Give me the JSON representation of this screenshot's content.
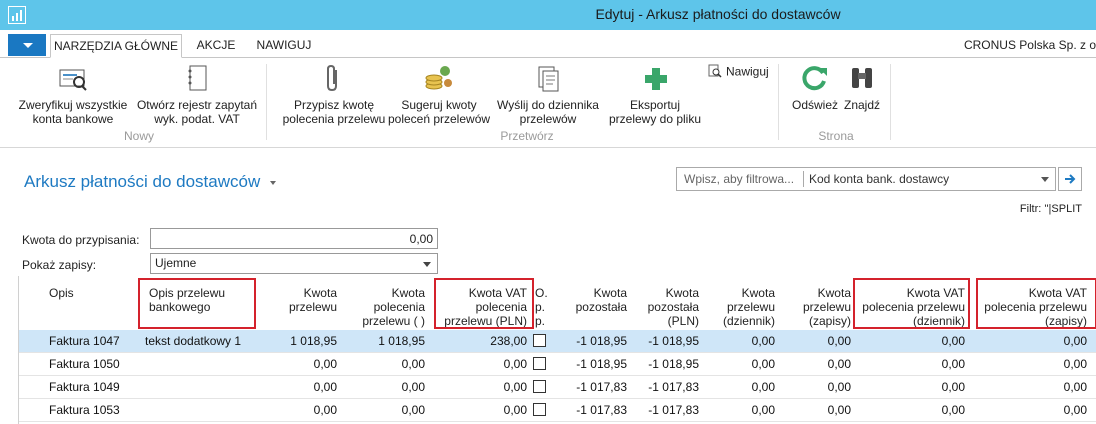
{
  "window": {
    "title": "Edytuj - Arkusz płatności do dostawców"
  },
  "ribbon_tabs": [
    {
      "label": "NARZĘDZIA GŁÓWNE",
      "active": true
    },
    {
      "label": "AKCJE",
      "active": false
    },
    {
      "label": "NAWIGUJ",
      "active": false
    }
  ],
  "company": "CRONUS Polska Sp. z o",
  "ribbon": {
    "groups": [
      {
        "label": "Nowy"
      },
      {
        "label": "Przetwórz"
      },
      {
        "label": "Strona"
      }
    ],
    "actions": [
      {
        "line1": "Zweryfikuj wszystkie",
        "line2": "konta bankowe",
        "icon": "verify-bank-icon"
      },
      {
        "line1": "Otwórz rejestr zapytań",
        "line2": "wyk. podat. VAT",
        "icon": "notebook-icon"
      },
      {
        "line1": "Przypisz kwotę",
        "line2": "polecenia przelewu",
        "icon": "paperclip-icon"
      },
      {
        "line1": "Sugeruj kwoty",
        "line2": "poleceń przelewów",
        "icon": "coins-icon"
      },
      {
        "line1": "Wyślij do dziennika",
        "line2": "przelewów",
        "icon": "document-icon"
      },
      {
        "line1": "Eksportuj",
        "line2": "przelewy do pliku",
        "icon": "plus-icon"
      },
      {
        "line1": "Odśwież",
        "line2": "",
        "icon": "refresh-icon"
      },
      {
        "line1": "Znajdź",
        "line2": "",
        "icon": "binoculars-icon"
      }
    ],
    "navigate_label": "Nawiguj"
  },
  "page": {
    "title": "Arkusz płatności do dostawców",
    "filter_placeholder": "Wpisz, aby filtrowa...",
    "filter_field": "Kod konta bank. dostawcy",
    "filter_text": "Filtr: ''|SPLIT"
  },
  "fields": {
    "amount_label": "Kwota do przypisania:",
    "amount_value": "0,00",
    "show_label": "Pokaż zapisy:",
    "show_value": "Ujemne"
  },
  "grid": {
    "headers": [
      "Opis",
      "Opis przelewu bankowego",
      "Kwota przelewu",
      "Kwota polecenia przelewu ( )",
      "Kwota VAT polecenia przelewu (PLN)",
      "O. p. p.",
      "Kwota pozostała",
      "Kwota pozostała (PLN)",
      "Kwota przelewu (dziennik)",
      "Kwota przelewu (zapisy)",
      "Kwota VAT polecenia przelewu (dziennik)",
      "Kwota VAT polecenia przelewu (zapisy)"
    ],
    "rows": [
      {
        "opis": "Faktura 1047",
        "opis_przelewu": "tekst dodatkowy 1",
        "kwota_przelewu": "1 018,95",
        "kwota_polecenia": "1 018,95",
        "vat_pln": "238,00",
        "op": false,
        "pozostala": "-1 018,95",
        "pozostala_pln": "-1 018,95",
        "przelewu_dziennik": "0,00",
        "przelewu_zapisy": "0,00",
        "vat_dziennik": "0,00",
        "vat_zapisy": "0,00",
        "selected": true
      },
      {
        "opis": "Faktura 1050",
        "opis_przelewu": "",
        "kwota_przelewu": "0,00",
        "kwota_polecenia": "0,00",
        "vat_pln": "0,00",
        "op": false,
        "pozostala": "-1 018,95",
        "pozostala_pln": "-1 018,95",
        "przelewu_dziennik": "0,00",
        "przelewu_zapisy": "0,00",
        "vat_dziennik": "0,00",
        "vat_zapisy": "0,00",
        "selected": false
      },
      {
        "opis": "Faktura 1049",
        "opis_przelewu": "",
        "kwota_przelewu": "0,00",
        "kwota_polecenia": "0,00",
        "vat_pln": "0,00",
        "op": false,
        "pozostala": "-1 017,83",
        "pozostala_pln": "-1 017,83",
        "przelewu_dziennik": "0,00",
        "przelewu_zapisy": "0,00",
        "vat_dziennik": "0,00",
        "vat_zapisy": "0,00",
        "selected": false
      },
      {
        "opis": "Faktura 1053",
        "opis_przelewu": "",
        "kwota_przelewu": "0,00",
        "kwota_polecenia": "0,00",
        "vat_pln": "0,00",
        "op": false,
        "pozostala": "-1 017,83",
        "pozostala_pln": "-1 017,83",
        "przelewu_dziennik": "0,00",
        "przelewu_zapisy": "0,00",
        "vat_dziennik": "0,00",
        "vat_zapisy": "0,00",
        "selected": false
      }
    ]
  },
  "colors": {
    "titlebar": "#5ec5ea",
    "accent": "#1e7ac2",
    "highlight_box": "#d4222c",
    "selected_row": "#cfe6f8"
  }
}
